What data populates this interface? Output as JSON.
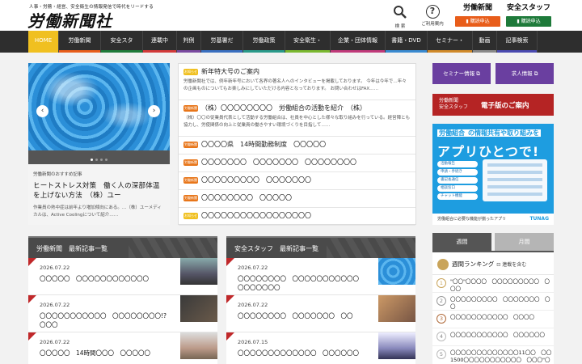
{
  "header": {
    "tagline": "人事・労務・経営、安全衛生の情報発信で時代をリードする",
    "logo": "労働新聞社",
    "search_label": "検 索",
    "help_label": "ご利用案内",
    "brand_rodo": {
      "name": "労働新聞",
      "button": "購読申込"
    },
    "brand_anzen": {
      "name": "安全スタッフ",
      "button": "購読申込"
    }
  },
  "nav": [
    {
      "label": "HOME",
      "color": "#f0c020"
    },
    {
      "label": "労働新聞",
      "color": "#e85d1a"
    },
    {
      "label": "安全スタ",
      "color": "#1e7a3a"
    },
    {
      "label": "連載中",
      "color": "#d23a3a"
    },
    {
      "label": "判例",
      "color": "#7a4aa0"
    },
    {
      "label": "労基署だ",
      "color": "#3a6fc0"
    },
    {
      "label": "労働政策",
      "color": "#2a9a8a"
    },
    {
      "label": "安全衛生・",
      "color": "#7ab830"
    },
    {
      "label": "企業・団体情報",
      "color": "#c03a7a"
    },
    {
      "label": "書籍・DVD",
      "color": "#3a8ad0"
    },
    {
      "label": "セミナー・",
      "color": "#d08a2a"
    },
    {
      "label": "動画",
      "color": "#8a8a8a"
    },
    {
      "label": "記事検索",
      "color": "#4a4ab0"
    }
  ],
  "slider": {
    "category": "労働新聞のおすすめ記事",
    "title": "ヒートストレス対策　働く人の深部体温を上げない方法　（株）ユー",
    "desc": "作業員の熱中症は前年より増加傾向にある。…（株）ユーメディカルは、Active Coolingについて紹介……",
    "prev": "‹",
    "next": "›"
  },
  "news": [
    {
      "tag": "お知らせ",
      "tag_color": "yellow",
      "title": "新年特大号のご案内",
      "desc": "労働新聞社では、例年新年号において各界の著名人へのインタビューを掲載しております。 今年は今年で…年々の企画ものについてもお楽しみにしていただける内容となっております。 お問い合わせはFAX……"
    },
    {
      "tag": "労働新聞",
      "tag_color": "orange",
      "title": "（株）〇〇〇〇〇〇〇〇　労働組合の活動を紹介　（株）",
      "desc": "（株）〇〇の従業員代表として活動する労働組合は、社員を中心とした様々な取り組みを行っている。経営陣とも協力し、労使関係の向上と従業員の働きやすい環境づくりを目指して……"
    },
    {
      "tag": "労働新聞",
      "tag_color": "orange",
      "title": "〇〇〇〇県　14時間勤務制度　〇〇〇〇〇",
      "desc": ""
    },
    {
      "tag": "労働新聞",
      "tag_color": "orange",
      "title": "〇〇〇〇〇〇〇　〇〇〇〇〇〇〇　〇〇〇〇〇〇〇〇",
      "desc": ""
    },
    {
      "tag": "労働新聞",
      "tag_color": "orange",
      "title": "〇〇〇〇〇〇〇〇〇　〇〇〇〇〇〇〇",
      "desc": ""
    },
    {
      "tag": "労働新聞",
      "tag_color": "orange",
      "title": "〇〇〇〇〇〇〇〇　〇〇〇〇〇",
      "desc": ""
    },
    {
      "tag": "お知らせ",
      "tag_color": "yellow",
      "title": "〇〇〇〇〇〇〇〇〇〇〇〇〇〇〇〇〇",
      "desc": ""
    }
  ],
  "right": {
    "btn1": "セミナー情報",
    "btn2": "求人情報",
    "denshi_small1": "労働新聞",
    "denshi_small2": "安全スタッフ",
    "denshi_big": "電子版のご案内",
    "tunag_l1_pre": "労働組合",
    "tunag_l1_post": "の情報共有や取り組みを",
    "tunag_l2": "アプリひとつで!",
    "tunag_features": [
      "活動報告",
      "申請・手続き",
      "書記長通信",
      "相談窓口",
      "チャット機能"
    ],
    "tunag_foot": "労働組合に必要な機能が揃ったアプリ",
    "tunag_brand": "TUNAG"
  },
  "sections": {
    "left": {
      "title": "労働新聞　最新記事一覧",
      "items": [
        {
          "date": "2026.07.22",
          "title": "〇〇〇〇〇　〇〇〇〇〇〇〇〇〇〇〇〇"
        },
        {
          "date": "2026.07.22",
          "title": "〇〇〇〇〇〇〇〇〇〇〇　〇〇〇〇〇〇〇〇!?　〇〇〇"
        },
        {
          "date": "2026.07.22",
          "title": "〇〇〇〇〇　14時間〇〇〇　〇〇〇〇〇"
        }
      ]
    },
    "mid": {
      "title": "安全スタッフ　最新記事一覧",
      "items": [
        {
          "date": "2026.07.22",
          "title": "〇〇〇〇〇〇〇〇　〇〇〇〇〇〇〇〇〇〇〇　〇〇〇〇〇〇〇"
        },
        {
          "date": "2026.07.22",
          "title": "〇〇〇〇〇〇〇〇　〇〇〇〇〇〇〇　〇〇"
        },
        {
          "date": "2026.07.15",
          "title": "〇〇〇〇〇〇〇〇〇〇〇〇〇　〇〇〇〇〇〇"
        }
      ]
    }
  },
  "ranking": {
    "tab1": "週間",
    "tab2": "月間",
    "head": "週間ランキング",
    "head_sub": "連載を含む",
    "items": [
      {
        "num": "1",
        "title": "\"〇〇\"〇〇〇〇　〇〇〇〇〇〇〇〇〇　〇〇〇"
      },
      {
        "num": "2",
        "title": "〇〇〇〇〇〇〇〇〇　〇〇〇〇〇〇〇　〇〇"
      },
      {
        "num": "3",
        "title": "〇〇〇〇〇〇〇〇〇〇〇　〇〇〇〇"
      },
      {
        "num": "4",
        "title": "〇〇〇〇〇〇〇〇〇〇〇　〇〇〇〇〇〇"
      },
      {
        "num": "5",
        "title": "〇〇〇〇〇〇〇〇〇〇〇〇〇11〇〇　〇〇1500〇〇〇〇〇〇〇〇〇〇〇　〇〇〇\"〇〇〇〇〇〇"
      }
    ]
  }
}
